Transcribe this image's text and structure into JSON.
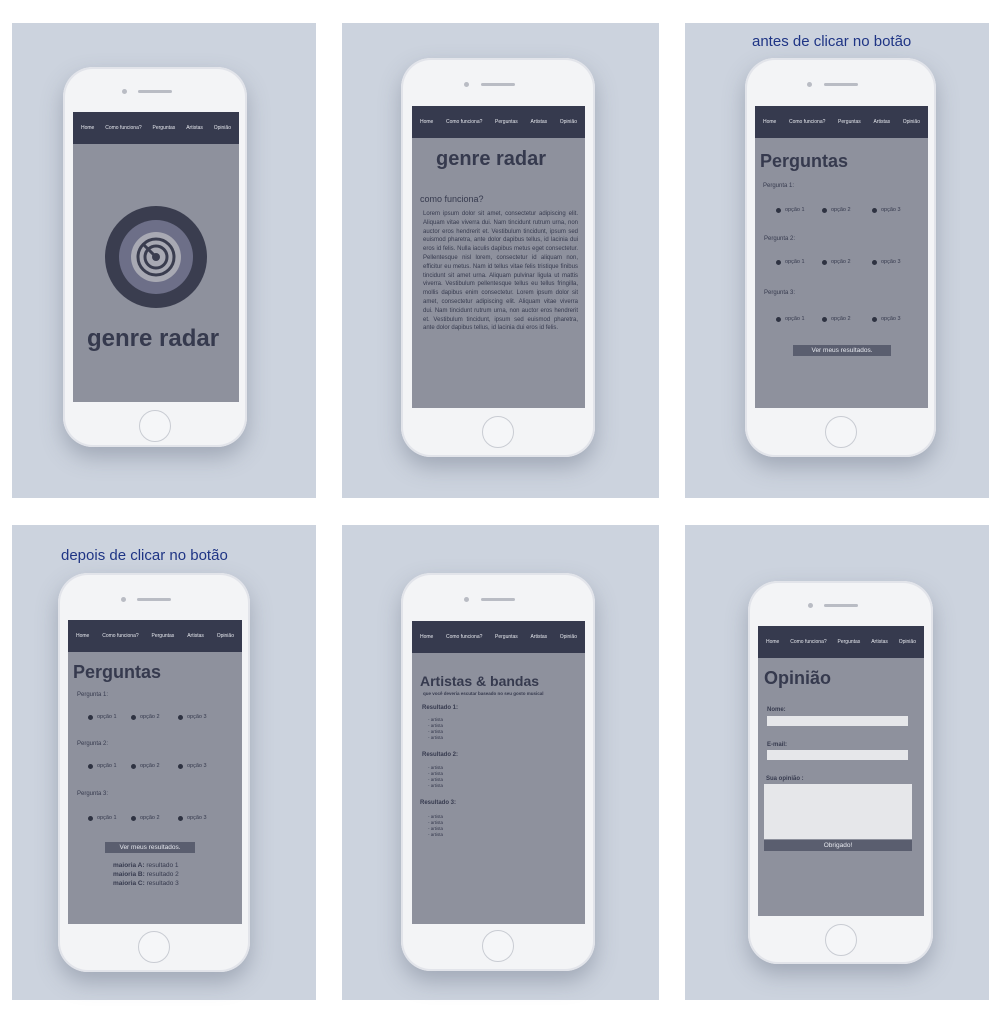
{
  "nav": {
    "home": "Home",
    "como": "Como funciona?",
    "perguntas": "Perguntas",
    "artistas": "Artistas",
    "opiniao": "Opinião"
  },
  "captions": {
    "antes": "antes de clicar no botão",
    "depois": "depois de clicar no botão"
  },
  "home": {
    "title": "genre radar"
  },
  "como": {
    "title": "genre radar",
    "heading": "como funciona?",
    "body": "Lorem ipsum dolor sit amet, consectetur adipiscing elit. Aliquam vitae viverra dui. Nam tincidunt rutrum urna, non auctor eros hendrerit et. Vestibulum tincidunt, ipsum sed euismod pharetra, ante dolor dapibus tellus, id lacinia dui eros id felis. Nulla iaculis dapibus metus eget consectetur. Pellentesque nisl lorem, consectetur id aliquam non, efficitur eu metus. Nam id tellus vitae felis tristique finibus tincidunt sit amet urna. Aliquam pulvinar ligula ut mattis viverra. Vestibulum pellentesque tellus eu tellus fringilla, mollis dapibus enim consectetur. Lorem ipsum dolor sit amet, consectetur adipiscing elit. Aliquam vitae viverra dui. Nam tincidunt rutrum urna, non auctor eros hendrerit et. Vestibulum tincidunt, ipsum sed euismod pharetra, ante dolor dapibus tellus, id lacinia dui eros id felis."
  },
  "perguntas": {
    "title": "Perguntas",
    "q1": "Pergunta 1:",
    "q2": "Pergunta 2:",
    "q3": "Pergunta 3:",
    "opt1": "opção 1",
    "opt2": "opção 2",
    "opt3": "opção 3",
    "button": "Ver meus resultados.",
    "results": [
      {
        "label": "maioria A:",
        "value": "resultado 1"
      },
      {
        "label": "maioria B:",
        "value": "resultado 2"
      },
      {
        "label": "maioria C:",
        "value": "resultado 3"
      }
    ]
  },
  "artistas": {
    "title": "Artistas & bandas",
    "subtitle": "que você deveria escutar baseado no seu gosto musical",
    "r1": "Resultado 1:",
    "r2": "Resultado 2:",
    "r3": "Resultado 3:",
    "item": "- artista"
  },
  "opiniao": {
    "title": "Opinião",
    "nome": "Nome:",
    "email": "E-mail:",
    "sua": "Sua opinião :",
    "button": "Obrigado!"
  },
  "colors": {
    "background": "#ccd3de",
    "screen": "#8e919d",
    "nav": "#363a4e",
    "caption": "#1f3585"
  }
}
